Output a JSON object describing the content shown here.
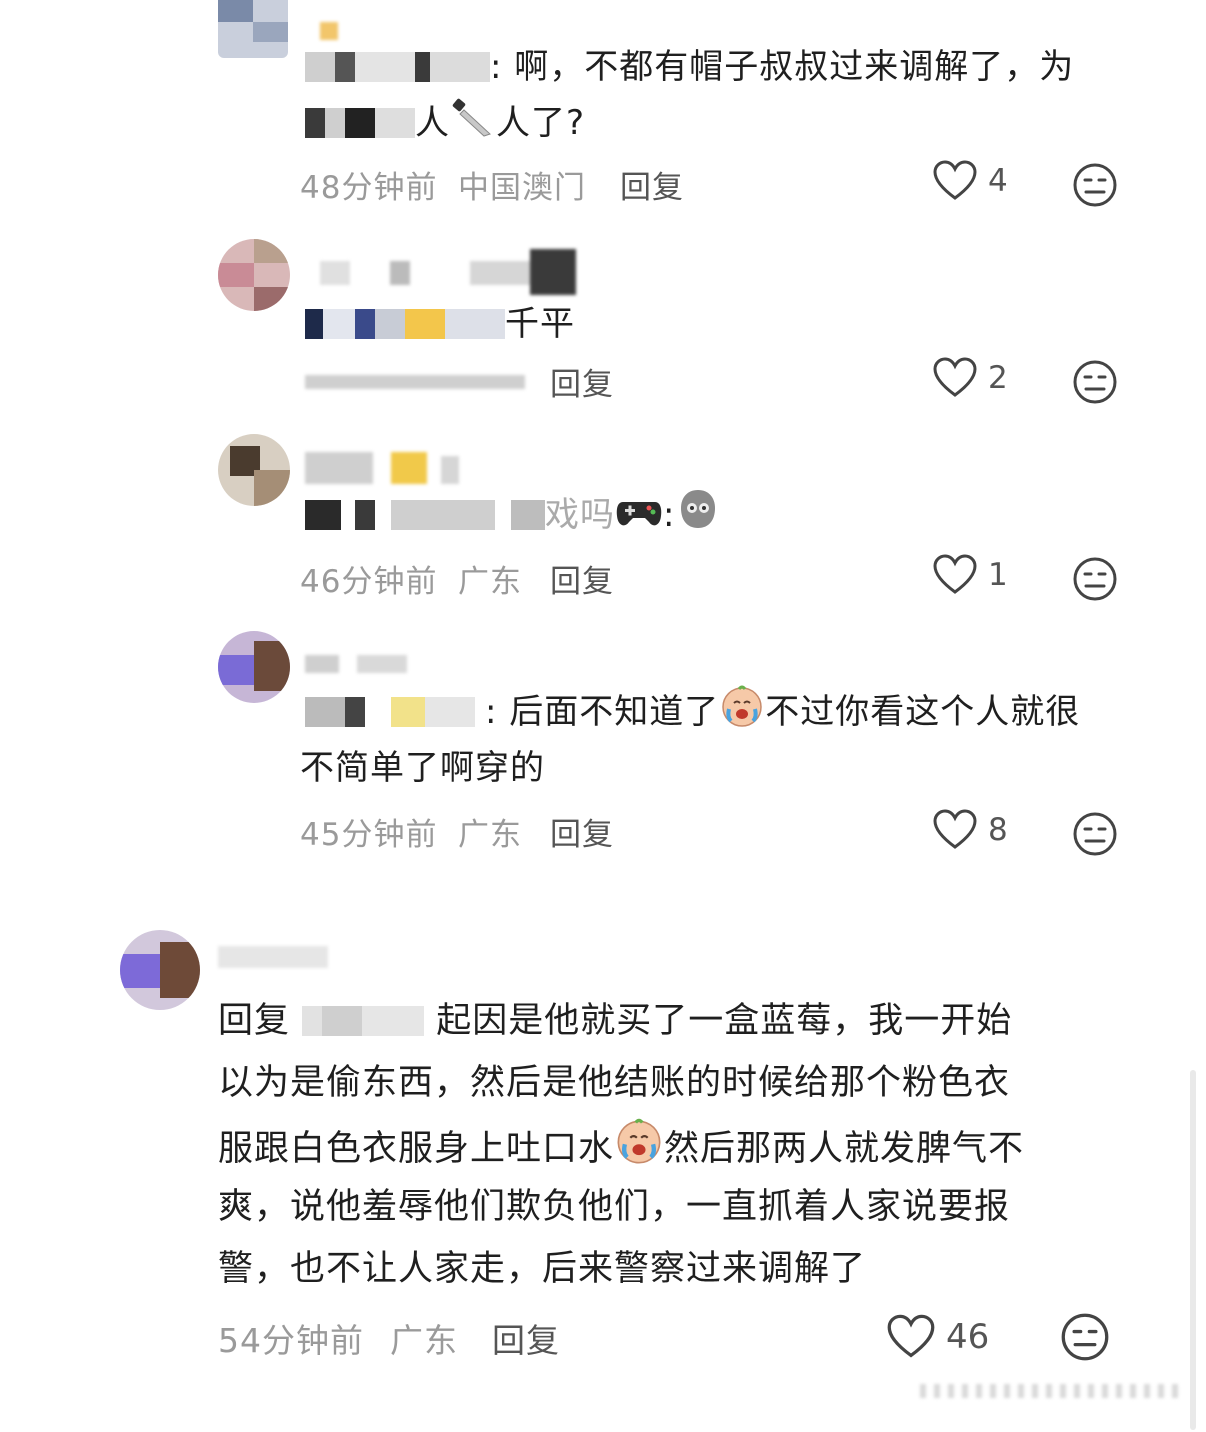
{
  "comments": [
    {
      "text_line1": ": 啊，不都有帽子叔叔过来调解了，为",
      "text_line2_a": "人",
      "text_line2_b": "人了?",
      "time": "48分钟前",
      "location": "中国澳门",
      "reply_label": "回复",
      "likes": "4"
    },
    {
      "text_line1_tail": "千平",
      "reply_label": "回复",
      "likes": "2"
    },
    {
      "text_line1_mid": "戏吗",
      "text_line1_tail": ":",
      "time": "46分钟前",
      "location": "广东",
      "reply_label": "回复",
      "likes": "1"
    },
    {
      "text_line1_a": ": 后面不知道了",
      "text_line1_b": "不过你看这个人就很",
      "text_line2": "不简单了啊穿的",
      "time": "45分钟前",
      "location": "广东",
      "reply_label": "回复",
      "likes": "8"
    }
  ],
  "main_comment": {
    "reply_prefix": "回复",
    "line1": "起因是他就买了一盒蓝莓，我一开始",
    "line2": "以为是偷东西，然后是他结账的时候给那个粉色衣",
    "line3_a": "服跟白色衣服身上吐口水",
    "line3_b": "然后那两人就发脾气不",
    "line4": "爽，说他羞辱他们欺负他们，一直抓着人家说要报",
    "line5": "警，也不让人家走，后来警察过来调解了",
    "time": "54分钟前",
    "location": "广东",
    "reply_label": "回复",
    "likes": "46"
  },
  "icons": {
    "like": "heart-outline-icon",
    "dislike": "neutral-face-icon"
  },
  "colors": {
    "text": "#1f1f1f",
    "meta": "#9a9a9a",
    "icon": "#444444"
  }
}
